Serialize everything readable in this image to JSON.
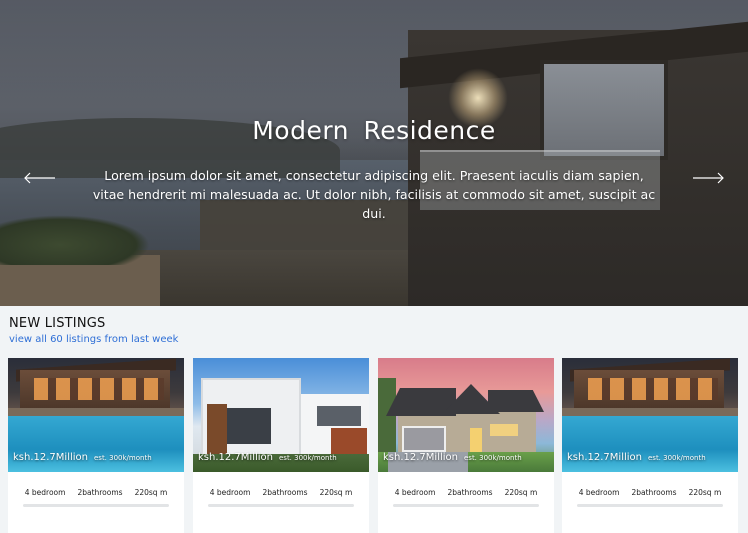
{
  "hero": {
    "title": "Modern  Residence",
    "description": "Lorem ipsum dolor sit amet, consectetur adipiscing elit. Praesent iaculis diam sapien, vitae hendrerit mi malesuada ac. Ut dolor nibh, facilisis at commodo sit amet, suscipit ac dui.",
    "prev_icon": "arrow-left-icon",
    "next_icon": "arrow-right-icon"
  },
  "listings": {
    "heading": "NEW LISTINGS",
    "link": "view all 60 listings from last week",
    "cards": [
      {
        "price": "ksh.12.7Million",
        "est": "est. 300k/month",
        "bedrooms": "4 bedroom",
        "bathrooms": "2bathrooms",
        "area": "220sq m",
        "photo": "pool-villa"
      },
      {
        "price": "ksh.12.7Million",
        "est": "est. 300k/month",
        "bedrooms": "4 bedroom",
        "bathrooms": "2bathrooms",
        "area": "220sq m",
        "photo": "modern-house"
      },
      {
        "price": "ksh.12.7Million",
        "est": "est. 300k/month",
        "bedrooms": "4 bedroom",
        "bathrooms": "2bathrooms",
        "area": "220sq m",
        "photo": "suburban-house"
      },
      {
        "price": "ksh.12.7Million",
        "est": "est. 300k/month",
        "bedrooms": "4 bedroom",
        "bathrooms": "2bathrooms",
        "area": "220sq m",
        "photo": "pool-villa"
      }
    ]
  },
  "colors": {
    "link": "#2f6fd6",
    "page_background": "#f1f4f6"
  }
}
